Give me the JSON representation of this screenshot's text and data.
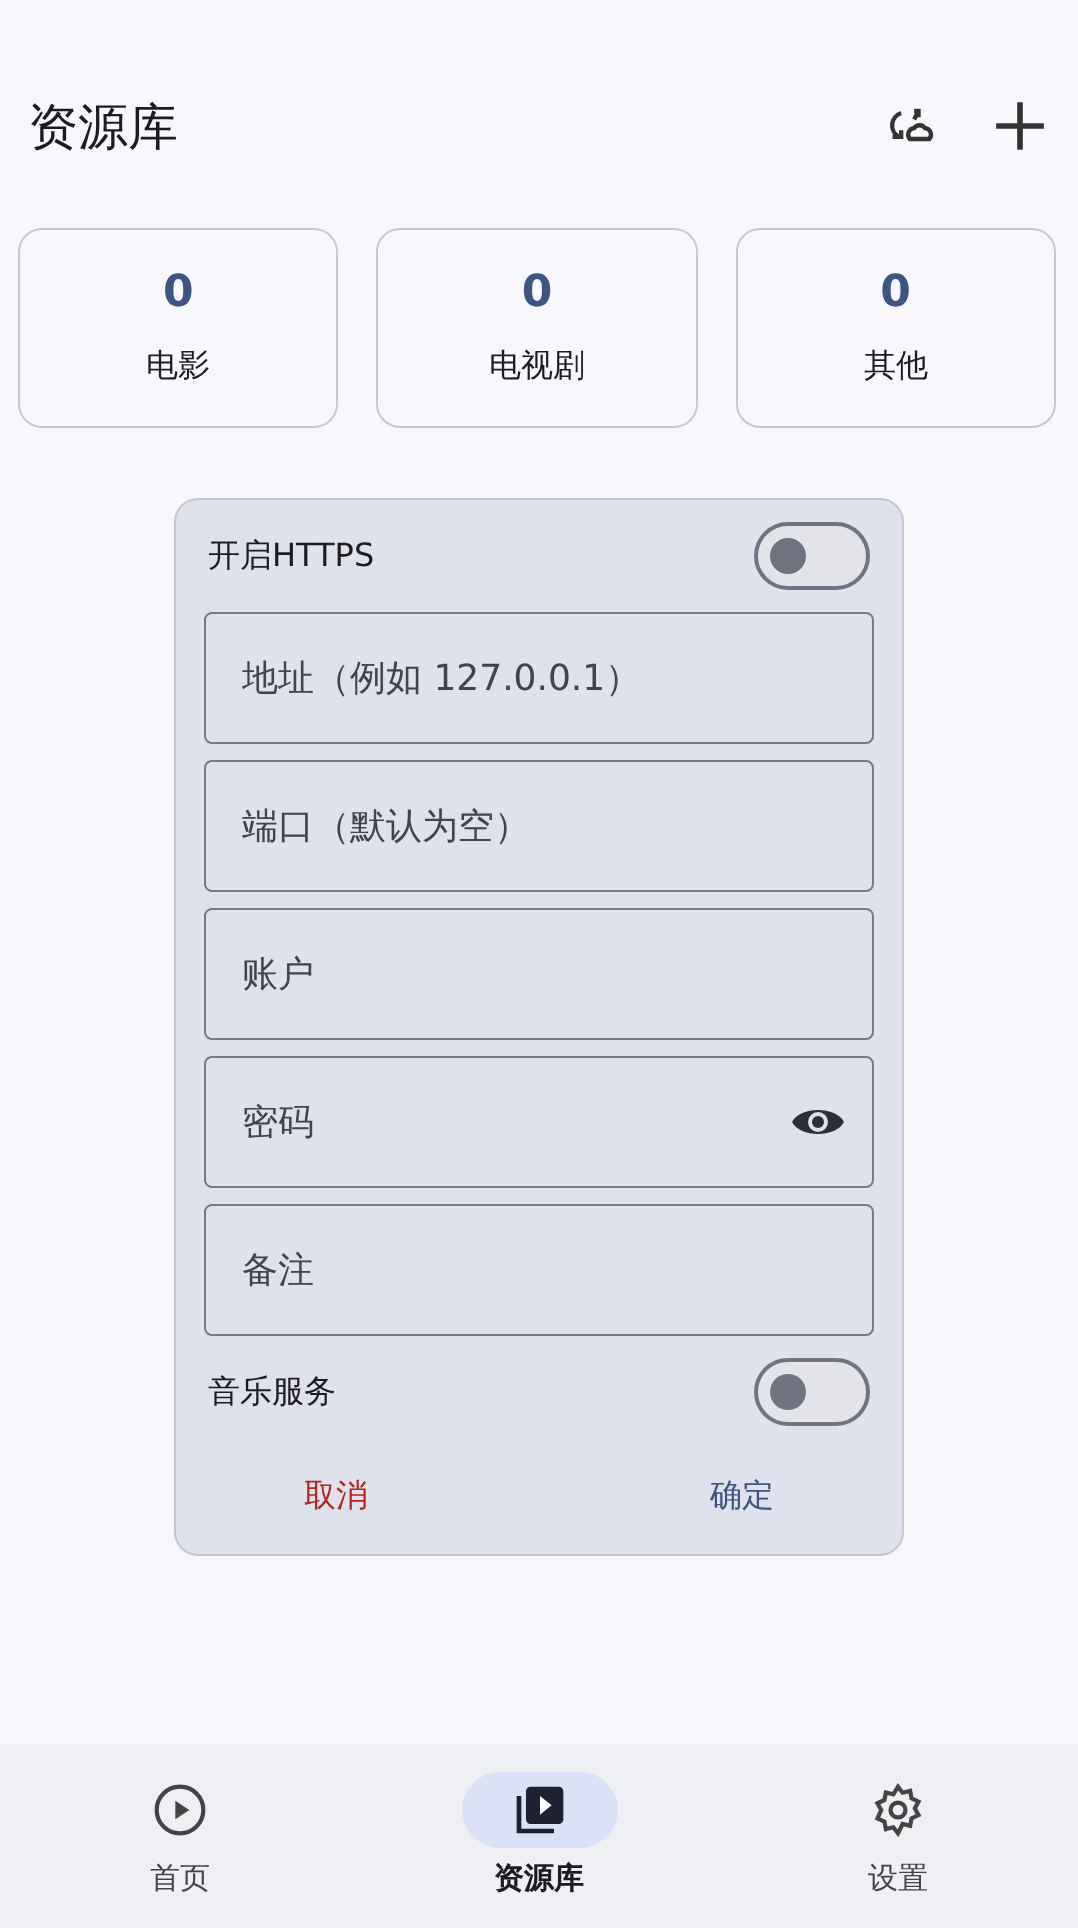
{
  "header": {
    "title": "资源库"
  },
  "stats": [
    {
      "count": "0",
      "label": "电影"
    },
    {
      "count": "0",
      "label": "电视剧"
    },
    {
      "count": "0",
      "label": "其他"
    }
  ],
  "dialog": {
    "https": {
      "label": "开启HTTPS",
      "on": false
    },
    "fields": [
      {
        "kind": "text",
        "placeholder": "地址（例如 127.0.0.1）"
      },
      {
        "kind": "text",
        "placeholder": "端口（默认为空）"
      },
      {
        "kind": "text",
        "placeholder": "账户"
      },
      {
        "kind": "password",
        "placeholder": "密码"
      },
      {
        "kind": "text",
        "placeholder": "备注"
      }
    ],
    "music": {
      "label": "音乐服务",
      "on": false
    },
    "cancel": "取消",
    "confirm": "确定"
  },
  "nav": [
    {
      "kind": "home",
      "label": "首页",
      "selected": false
    },
    {
      "kind": "library",
      "label": "资源库",
      "selected": true
    },
    {
      "kind": "settings",
      "label": "设置",
      "selected": false
    }
  ]
}
